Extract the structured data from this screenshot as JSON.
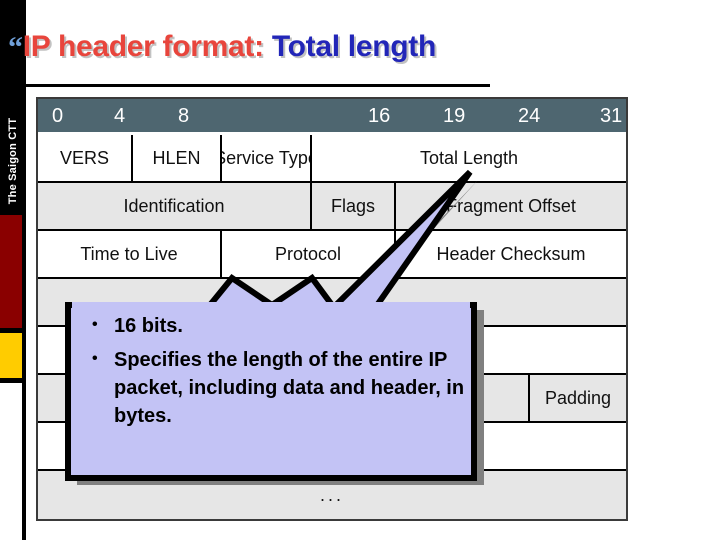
{
  "slide": {
    "title": {
      "bullet_icon": "quote-bullet-icon",
      "bullet_glyph": "“",
      "red_part": "IP header format:",
      "blue_part": "Total length",
      "red_color": "#e8453c",
      "blue_color": "#2226b8"
    },
    "sidebar": {
      "label": "The Saigon CTT",
      "black_color": "#000000",
      "red_color": "#8a0000",
      "gold_color": "#ffcc00"
    }
  },
  "ip_header_table": {
    "header_bg": "#4e6670",
    "bit_ruler": [
      "0",
      "4",
      "8",
      "16",
      "19",
      "24",
      "31"
    ],
    "rows": [
      {
        "shade": "white",
        "cells": [
          "VERS",
          "HLEN",
          "Service Type",
          "Total Length"
        ]
      },
      {
        "shade": "gray",
        "cells": [
          "Identification",
          "Flags",
          "Fragment  Offset"
        ]
      },
      {
        "shade": "white",
        "cells": [
          "Time to Live",
          "Protocol",
          "Header Checksum"
        ]
      },
      {
        "shade": "gray",
        "cells": [
          "",
          ""
        ]
      },
      {
        "shade": "white",
        "cells": [
          ""
        ]
      },
      {
        "shade": "gray",
        "cells": [
          "",
          "Padding"
        ]
      },
      {
        "shade": "white",
        "cells": [
          ""
        ]
      },
      {
        "shade": "gray",
        "cells": [
          "..."
        ]
      }
    ]
  },
  "callout": {
    "fill_color": "#c3c3f5",
    "border_color": "#000000",
    "shadow_color": "#808080",
    "bullets": [
      "16 bits.",
      "Specifies the length of the entire IP packet, including data and header, in bytes."
    ]
  }
}
